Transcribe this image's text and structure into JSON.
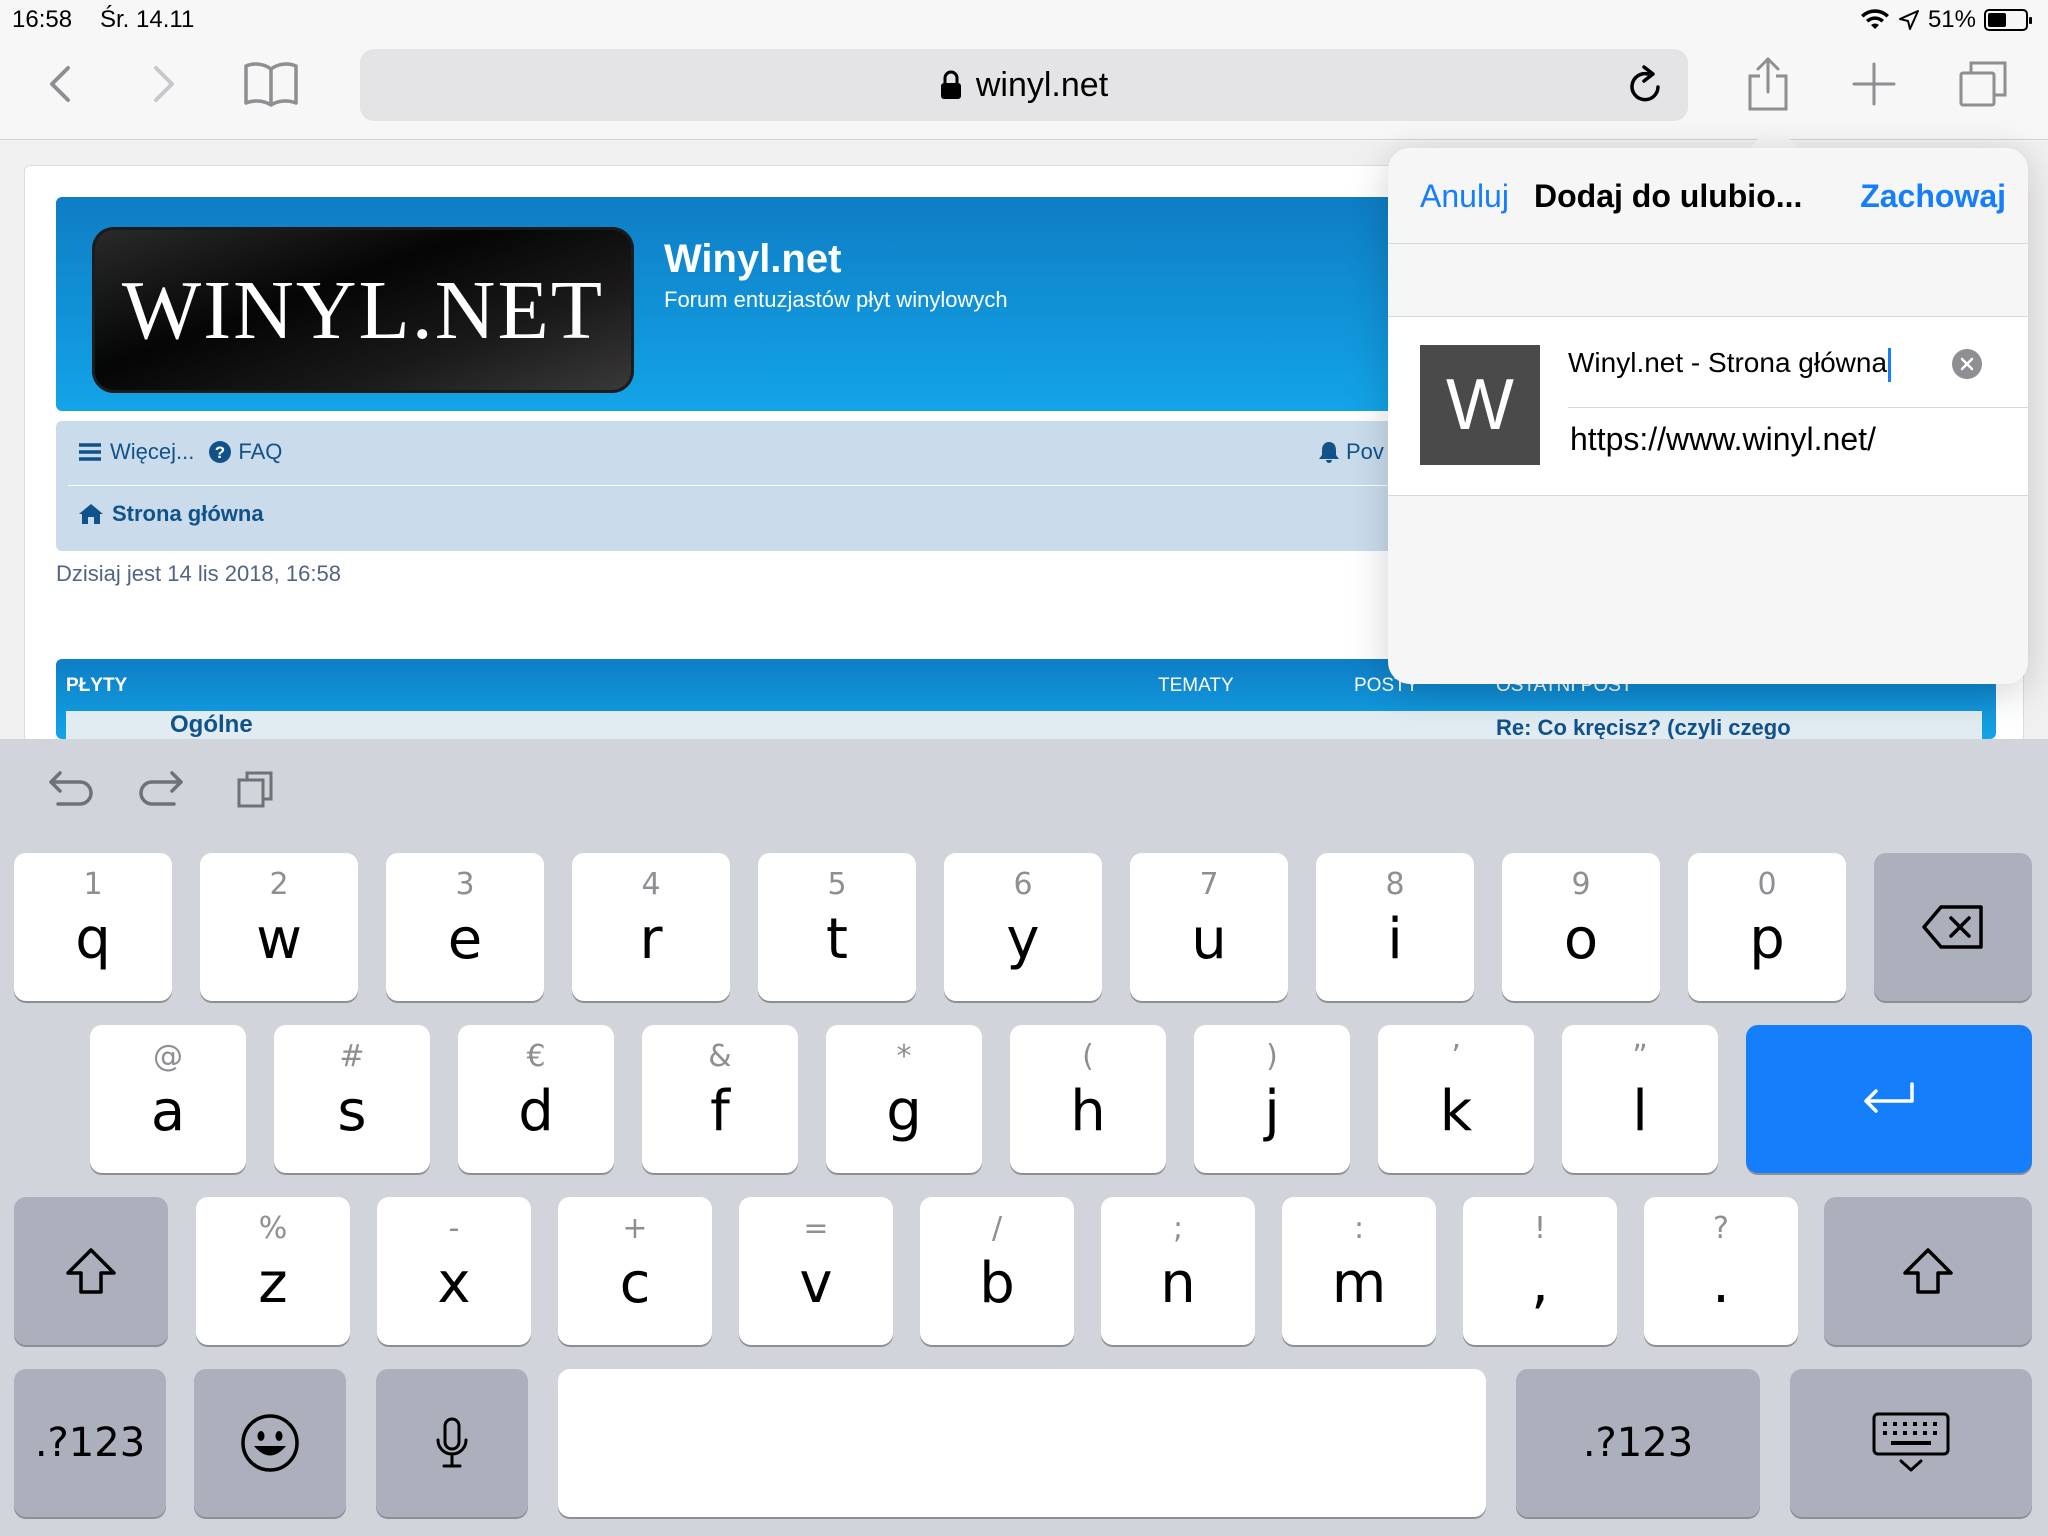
{
  "status_bar": {
    "time": "16:58",
    "date": "Śr. 14.11",
    "battery": "51%",
    "battery_level": 0.51
  },
  "toolbar": {
    "url": "winyl.net"
  },
  "page": {
    "logo_text": "WINYL.NET",
    "site_title": "Winyl.net",
    "site_subtitle": "Forum entuzjastów płyt winylowych",
    "nav": {
      "more": "Więcej...",
      "faq": "FAQ",
      "notifications_partial": "Pov",
      "home": "Strona główna"
    },
    "today": "Dzisiaj jest 14 lis 2018, 16:58",
    "forum_table": {
      "header_section": "PŁYTY",
      "col_topics": "TEMATY",
      "col_posts": "POSTY",
      "col_last": "OSTATNI POST",
      "first_row_name": "Ogólne",
      "first_row_last": "Re: Co kręcisz? (czyli czego"
    }
  },
  "bookmark_popover": {
    "cancel": "Anuluj",
    "title": "Dodaj do ulubio...",
    "save": "Zachowaj",
    "thumb_letter": "W",
    "name_value": "Winyl.net - Strona główna",
    "url_value": "https://www.winyl.net/"
  },
  "keyboard": {
    "row1": [
      {
        "sec": "1",
        "pri": "q"
      },
      {
        "sec": "2",
        "pri": "w"
      },
      {
        "sec": "3",
        "pri": "e"
      },
      {
        "sec": "4",
        "pri": "r"
      },
      {
        "sec": "5",
        "pri": "t"
      },
      {
        "sec": "6",
        "pri": "y"
      },
      {
        "sec": "7",
        "pri": "u"
      },
      {
        "sec": "8",
        "pri": "i"
      },
      {
        "sec": "9",
        "pri": "o"
      },
      {
        "sec": "0",
        "pri": "p"
      }
    ],
    "row2": [
      {
        "sec": "@",
        "pri": "a"
      },
      {
        "sec": "#",
        "pri": "s"
      },
      {
        "sec": "€",
        "pri": "d"
      },
      {
        "sec": "&",
        "pri": "f"
      },
      {
        "sec": "*",
        "pri": "g"
      },
      {
        "sec": "(",
        "pri": "h"
      },
      {
        "sec": ")",
        "pri": "j"
      },
      {
        "sec": "’",
        "pri": "k"
      },
      {
        "sec": "”",
        "pri": "l"
      }
    ],
    "row3": [
      {
        "sec": "%",
        "pri": "z"
      },
      {
        "sec": "-",
        "pri": "x"
      },
      {
        "sec": "+",
        "pri": "c"
      },
      {
        "sec": "=",
        "pri": "v"
      },
      {
        "sec": "/",
        "pri": "b"
      },
      {
        "sec": ";",
        "pri": "n"
      },
      {
        "sec": ":",
        "pri": "m"
      },
      {
        "sec": "!",
        "pri": ","
      },
      {
        "sec": "?",
        "pri": "."
      }
    ],
    "numbers_label": ".?123"
  },
  "colors": {
    "accent": "#157efb",
    "banner": "#13a4e7",
    "nav_bg": "#cadcec",
    "link": "#105289"
  }
}
